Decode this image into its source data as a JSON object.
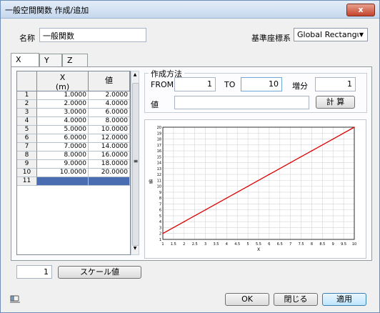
{
  "window": {
    "title": "一般空間関数 作成/追加",
    "close_label": "x"
  },
  "name_field": {
    "label": "名称",
    "value": "一般関数"
  },
  "coord_system": {
    "label": "基準座標系",
    "selected": "Global Rectangular"
  },
  "tabs": [
    {
      "label": "X"
    },
    {
      "label": "Y"
    },
    {
      "label": "Z"
    }
  ],
  "table": {
    "col_x_header": "X",
    "col_x_unit": "(m)",
    "col_value_header": "値",
    "rows": [
      {
        "n": "1",
        "x": "1.0000",
        "v": "2.0000"
      },
      {
        "n": "2",
        "x": "2.0000",
        "v": "4.0000"
      },
      {
        "n": "3",
        "x": "3.0000",
        "v": "6.0000"
      },
      {
        "n": "4",
        "x": "4.0000",
        "v": "8.0000"
      },
      {
        "n": "5",
        "x": "5.0000",
        "v": "10.0000"
      },
      {
        "n": "6",
        "x": "6.0000",
        "v": "12.0000"
      },
      {
        "n": "7",
        "x": "7.0000",
        "v": "14.0000"
      },
      {
        "n": "8",
        "x": "8.0000",
        "v": "16.0000"
      },
      {
        "n": "9",
        "x": "9.0000",
        "v": "18.0000"
      },
      {
        "n": "10",
        "x": "10.0000",
        "v": "20.0000"
      }
    ],
    "new_row_number": "11"
  },
  "creation": {
    "group_label": "作成方法",
    "from_label": "FROM",
    "from_value": "1",
    "to_label": "TO",
    "to_value": "10",
    "step_label": "増分",
    "step_value": "1",
    "value_label": "値",
    "value_text": "",
    "calc_button": "計 算"
  },
  "chart_data": {
    "type": "line",
    "x": [
      1,
      2,
      3,
      4,
      5,
      6,
      7,
      8,
      9,
      10
    ],
    "series": [
      {
        "values": [
          2,
          4,
          6,
          8,
          10,
          12,
          14,
          16,
          18,
          20
        ]
      }
    ],
    "xlim": [
      1,
      10
    ],
    "ylim": [
      1,
      20
    ],
    "xticks": [
      "1",
      "1.5",
      "2",
      "2.5",
      "3",
      "3.5",
      "4",
      "4.5",
      "5",
      "5.5",
      "6",
      "6.5",
      "7",
      "7.5",
      "8",
      "8.5",
      "9",
      "9.5",
      "10"
    ],
    "yticks": [
      "1",
      "2",
      "3",
      "4",
      "5",
      "6",
      "7",
      "8",
      "9",
      "10",
      "11",
      "12",
      "13",
      "14",
      "15",
      "16",
      "17",
      "18",
      "19",
      "20"
    ],
    "xlabel": "X",
    "ylabel": "値",
    "grid": true,
    "line_color": "#dd0000"
  },
  "scale": {
    "value": "1",
    "button": "スケール値"
  },
  "footer": {
    "ok": "OK",
    "close": "閉じる",
    "apply": "適用"
  },
  "colors": {
    "selected_row": "#4a6db1",
    "apply_border": "#3c7fb1"
  }
}
